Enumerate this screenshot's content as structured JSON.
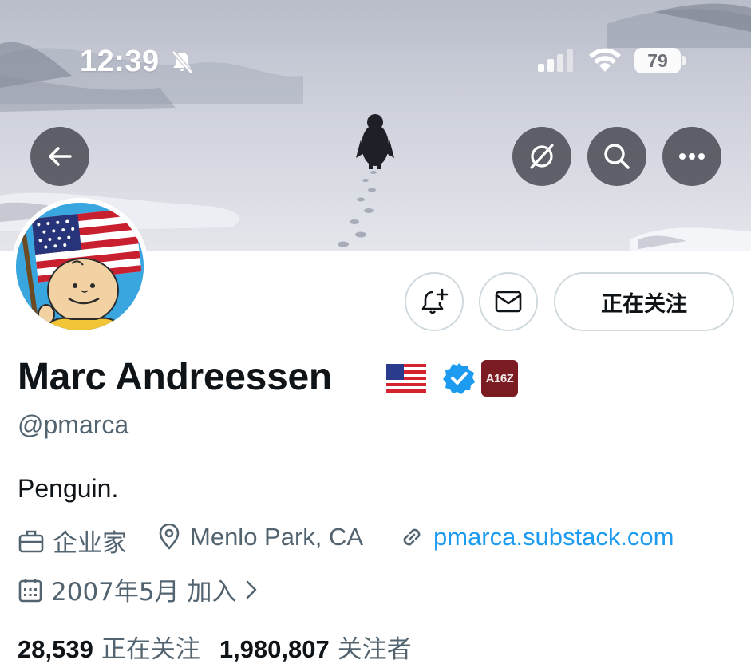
{
  "status_bar": {
    "time": "12:39",
    "battery_level": "79",
    "icons": [
      "bell-slash-icon",
      "cellular-signal-icon",
      "wifi-icon",
      "battery-icon"
    ]
  },
  "header_actions": {
    "icons": [
      "back-arrow-icon",
      "grok-icon",
      "search-icon",
      "more-icon"
    ]
  },
  "profile_actions": {
    "notify_icon": "bell-plus-icon",
    "message_icon": "envelope-icon",
    "following_label": "正在关注"
  },
  "profile": {
    "display_name": "Marc Andreessen",
    "flag_emoji": "🇺🇸",
    "affiliate_badge_text": "A16Z",
    "handle": "@pmarca",
    "bio": "Penguin.",
    "profession": "企业家",
    "location": "Menlo Park, CA",
    "website": "pmarca.substack.com",
    "joined": "2007年5月 加入"
  },
  "stats": {
    "following_count": "28,539",
    "following_label": "正在关注",
    "followers_count": "1,980,807",
    "followers_label": "关注者"
  },
  "colors": {
    "accent": "#1d9bf0",
    "secondary_text": "#536471",
    "primary_text": "#0f1419",
    "border": "#cfd9de",
    "affiliate_badge": "#7b1c22"
  }
}
